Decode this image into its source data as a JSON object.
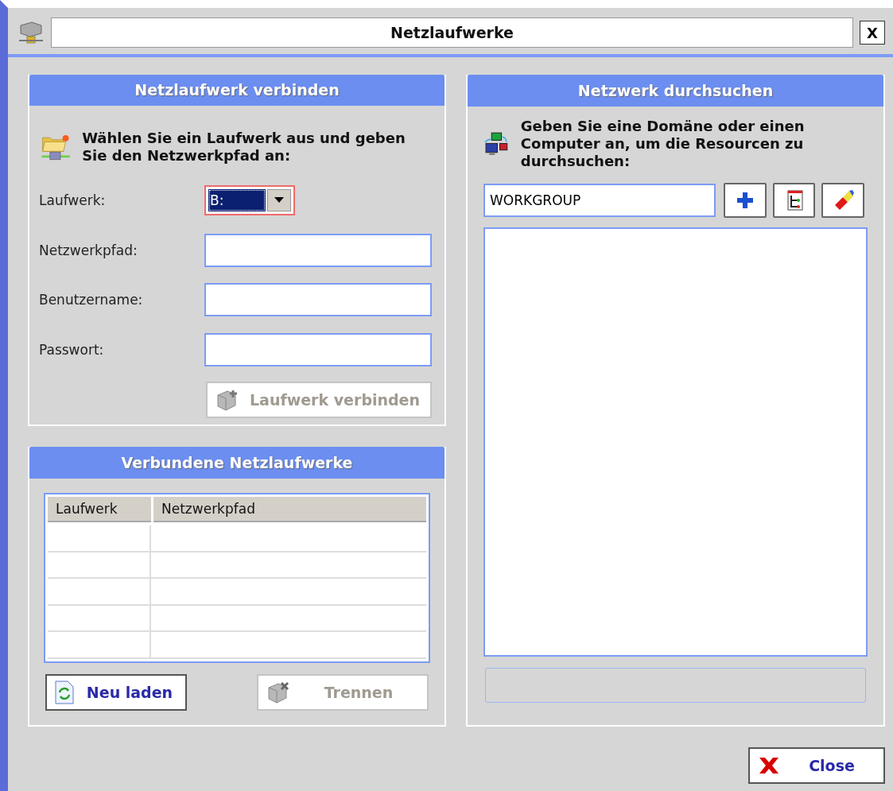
{
  "window": {
    "title": "Netzlaufwerke",
    "close_label": "X"
  },
  "connect_panel": {
    "title": "Netzlaufwerk verbinden",
    "intro": "Wählen Sie ein Laufwerk aus und geben Sie den Netzwerkpfad an:",
    "drive": {
      "label": "Laufwerk:",
      "value": "B:",
      "focused": true
    },
    "fields": [
      {
        "label": "Netzwerkpfad:"
      },
      {
        "label": "Benutzername:"
      },
      {
        "label": "Passwort:"
      }
    ],
    "button": {
      "label": "Laufwerk verbinden",
      "disabled": true
    }
  },
  "connected_panel": {
    "title": "Verbundene Netzlaufwerke",
    "columns": [
      "Laufwerk",
      "Netzwerkpfad"
    ],
    "buttons": [
      {
        "kind": "reload",
        "label": "Neu laden",
        "disabled": false
      },
      {
        "kind": "disconnect",
        "label": "Trennen",
        "disabled": true
      }
    ]
  },
  "browse_panel": {
    "title": "Netzwerk durchsuchen",
    "intro": "Geben Sie eine Domäne oder einen Computer an, um die Resourcen zu durchsuchen:",
    "domain_value": "WORKGROUP"
  },
  "close_button": {
    "label": "Close"
  }
}
